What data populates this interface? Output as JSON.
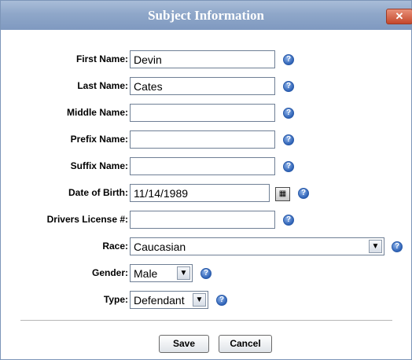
{
  "dialog": {
    "title": "Subject Information",
    "close_glyph": "✕"
  },
  "help_glyph": "?",
  "fields": {
    "first_name": {
      "label": "First Name:",
      "value": "Devin"
    },
    "last_name": {
      "label": "Last Name:",
      "value": "Cates"
    },
    "middle_name": {
      "label": "Middle Name:",
      "value": ""
    },
    "prefix_name": {
      "label": "Prefix Name:",
      "value": ""
    },
    "suffix_name": {
      "label": "Suffix Name:",
      "value": ""
    },
    "date_of_birth": {
      "label": "Date of Birth:",
      "value": "11/14/1989"
    },
    "drivers_license": {
      "label": "Drivers License #:",
      "value": ""
    },
    "race": {
      "label": "Race:",
      "value": "Caucasian"
    },
    "gender": {
      "label": "Gender:",
      "value": "Male"
    },
    "type": {
      "label": "Type:",
      "value": "Defendant"
    }
  },
  "buttons": {
    "save": "Save",
    "cancel": "Cancel"
  },
  "colors": {
    "titlebar": "#8fa7c9",
    "close_button": "#c4472b",
    "help_icon": "#2f63b7"
  }
}
